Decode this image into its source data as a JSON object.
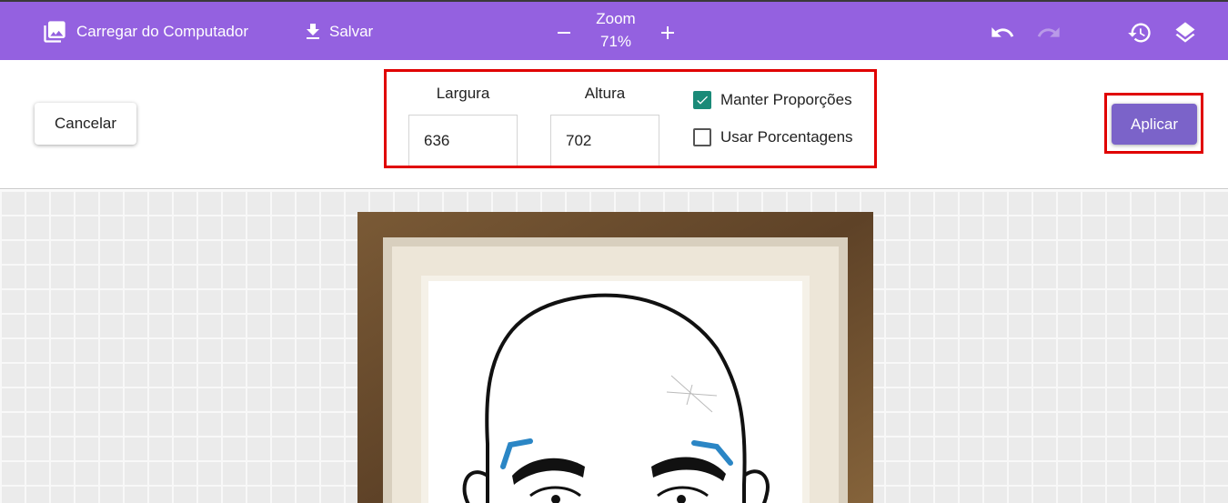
{
  "topbar": {
    "load_label": "Carregar do Computador",
    "save_label": "Salvar",
    "zoom_label": "Zoom",
    "zoom_value": "71%",
    "icons": [
      "image-icon",
      "download-icon",
      "minus-icon",
      "plus-icon",
      "undo-icon",
      "redo-icon",
      "history-icon",
      "layers-icon"
    ]
  },
  "resize": {
    "cancel_label": "Cancelar",
    "width_label": "Largura",
    "width_value": "636",
    "height_label": "Altura",
    "height_value": "702",
    "keep_ratio_label": "Manter Proporções",
    "keep_ratio_checked": true,
    "use_percent_label": "Usar Porcentagens",
    "use_percent_checked": false,
    "apply_label": "Aplicar"
  },
  "colors": {
    "topbar": "#9461e0",
    "apply": "#7b63c9",
    "checkbox": "#1a8a78",
    "highlight": "#e00000"
  }
}
